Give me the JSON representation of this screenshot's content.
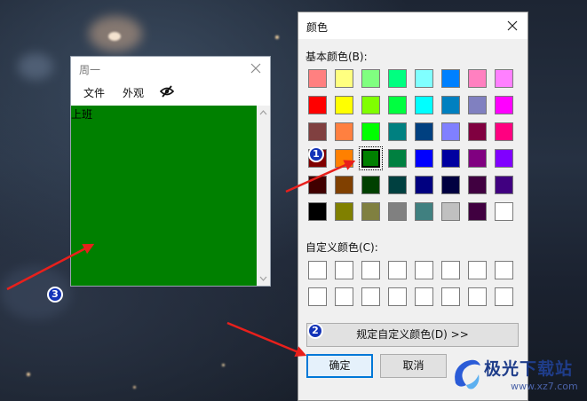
{
  "notepad": {
    "title": "周一",
    "menu": [
      "文件",
      "外观"
    ],
    "menu_icon": "eye-slash-icon",
    "content_text": "上班",
    "editor_color": "#008000"
  },
  "dialog": {
    "title": "颜色",
    "basic_colors_label": "基本颜色(B):",
    "custom_colors_label": "自定义颜色(C):",
    "basic_colors": [
      [
        "#ff8080",
        "#ffff80",
        "#80ff80",
        "#00ff80",
        "#80ffff",
        "#0080ff",
        "#ff80c0",
        "#ff80ff"
      ],
      [
        "#ff0000",
        "#ffff00",
        "#80ff00",
        "#00ff40",
        "#00ffff",
        "#0080c0",
        "#8080c0",
        "#ff00ff"
      ],
      [
        "#804040",
        "#ff8040",
        "#00ff00",
        "#008080",
        "#004080",
        "#8080ff",
        "#800040",
        "#ff0080"
      ],
      [
        "#800000",
        "#ff8000",
        "#008000",
        "#008040",
        "#0000ff",
        "#0000a0",
        "#800080",
        "#8000ff"
      ],
      [
        "#400000",
        "#804000",
        "#004000",
        "#004040",
        "#000080",
        "#000040",
        "#400040",
        "#400080"
      ],
      [
        "#000000",
        "#808000",
        "#808040",
        "#808080",
        "#408080",
        "#c0c0c0",
        "#400040",
        "#ffffff"
      ]
    ],
    "selected_color": {
      "row": 3,
      "col": 2
    },
    "custom_colors": [
      [
        "#ffffff",
        "#ffffff",
        "#ffffff",
        "#ffffff",
        "#ffffff",
        "#ffffff",
        "#ffffff",
        "#ffffff"
      ],
      [
        "#ffffff",
        "#ffffff",
        "#ffffff",
        "#ffffff",
        "#ffffff",
        "#ffffff",
        "#ffffff",
        "#ffffff"
      ]
    ],
    "define_custom_button": "规定自定义颜色(D) >>",
    "ok_button": "确定",
    "cancel_button": "取消"
  },
  "annotations": {
    "badges": [
      "1",
      "2",
      "3"
    ],
    "arrow_color": "#e8201c",
    "badge_color": "#1434b8"
  },
  "watermark": {
    "brand": "极光下载站",
    "url": "www.xz7.com"
  }
}
